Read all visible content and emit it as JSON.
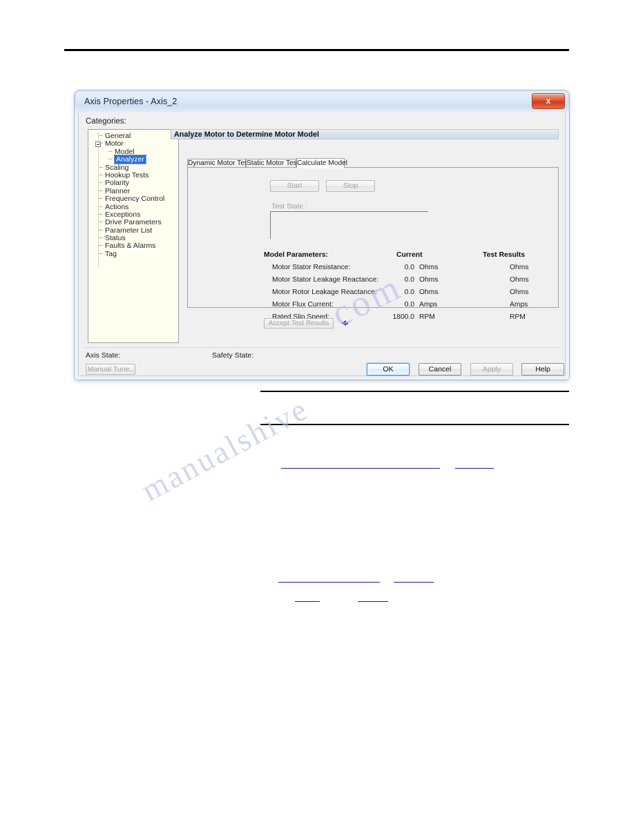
{
  "window": {
    "title": "Axis Properties - Axis_2",
    "close_label": "x",
    "close_icon": "close-icon"
  },
  "sidebar": {
    "label": "Categories:",
    "items": [
      {
        "label": "General",
        "level": 1,
        "selected": false,
        "expander": false
      },
      {
        "label": "Motor",
        "level": 1,
        "selected": false,
        "expander": true
      },
      {
        "label": "Model",
        "level": 2,
        "selected": false,
        "expander": false
      },
      {
        "label": "Analyzer",
        "level": 2,
        "selected": true,
        "expander": false
      },
      {
        "label": "Scaling",
        "level": 1,
        "selected": false,
        "expander": false
      },
      {
        "label": "Hookup Tests",
        "level": 1,
        "selected": false,
        "expander": false
      },
      {
        "label": "Polarity",
        "level": 1,
        "selected": false,
        "expander": false
      },
      {
        "label": "Planner",
        "level": 1,
        "selected": false,
        "expander": false
      },
      {
        "label": "Frequency Control",
        "level": 1,
        "selected": false,
        "expander": false
      },
      {
        "label": "Actions",
        "level": 1,
        "selected": false,
        "expander": false
      },
      {
        "label": "Exceptions",
        "level": 1,
        "selected": false,
        "expander": false
      },
      {
        "label": "Drive Parameters",
        "level": 1,
        "selected": false,
        "expander": false
      },
      {
        "label": "Parameter List",
        "level": 1,
        "selected": false,
        "expander": false
      },
      {
        "label": "Status",
        "level": 1,
        "selected": false,
        "expander": false
      },
      {
        "label": "Faults & Alarms",
        "level": 1,
        "selected": false,
        "expander": false
      },
      {
        "label": "Tag",
        "level": 1,
        "selected": false,
        "expander": false
      }
    ]
  },
  "pane": {
    "header": "Analyze Motor to Determine Motor Model",
    "tabs": [
      {
        "label": "Dynamic Motor Test",
        "active": false
      },
      {
        "label": "Static Motor Test",
        "active": false
      },
      {
        "label": "Calculate Model",
        "active": true
      }
    ],
    "start_button": "Start",
    "stop_button": "Stop",
    "test_state_label": "Test State :",
    "test_state_value": "",
    "accept_button": "Accept Test Results",
    "arrow_icon": "arrow-left-icon",
    "table": {
      "header_parameters": "Model Parameters:",
      "header_current": "Current",
      "header_results": "Test Results",
      "rows": [
        {
          "name": "Motor Stator Resistance:",
          "current": "0.0",
          "unit": "Ohms",
          "result": "",
          "result_unit": "Ohms"
        },
        {
          "name": "Motor Stator Leakage Reactance:",
          "current": "0.0",
          "unit": "Ohms",
          "result": "",
          "result_unit": "Ohms"
        },
        {
          "name": "Motor Rotor Leakage Reactance:",
          "current": "0.0",
          "unit": "Ohms",
          "result": "",
          "result_unit": "Ohms"
        },
        {
          "name": "Motor Flux Current:",
          "current": "0.0",
          "unit": "Amps",
          "result": "",
          "result_unit": "Amps"
        },
        {
          "name": "Rated Slip Speed:",
          "current": "1800.0",
          "unit": "RPM",
          "result": "",
          "result_unit": "RPM"
        }
      ]
    }
  },
  "footer": {
    "axis_state_label": "Axis State:",
    "axis_state_value": "",
    "safety_state_label": "Safety State:",
    "safety_state_value": "",
    "manual_tune_button": "Manual Tune..",
    "ok_button": "OK",
    "cancel_button": "Cancel",
    "apply_button": "Apply",
    "help_button": "Help"
  },
  "watermark": {
    "line1": "manualshive",
    "line2": "com"
  },
  "colors": {
    "accent": "#2a6fd6",
    "close_button": "#cd3c1d",
    "link_underline": "#1b1b8f",
    "arrow": "#2f2fb0"
  }
}
